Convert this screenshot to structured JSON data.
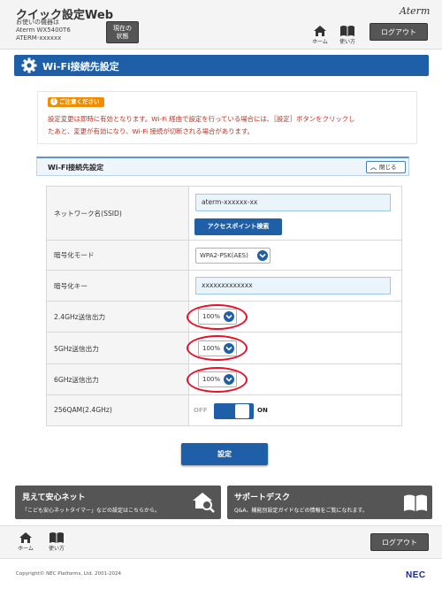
{
  "header": {
    "app_title": "クイック設定Web",
    "device_label": "お使いの機器は",
    "device_model": "Aterm WX5400T6",
    "device_id": "ATERM-xxxxxx",
    "status_button_line1": "現在の",
    "status_button_line2": "状態",
    "brand_logo": "Aterm",
    "home_label": "ホーム",
    "help_label": "使い方",
    "logout_label": "ログアウト"
  },
  "page": {
    "title": "Wi-Fi接続先設定"
  },
  "caution": {
    "badge": "ご注意ください",
    "line1": "設定変更は即時に有効となります。Wi-Fi 経由で設定を行っている場合には、［設定］ボタンをクリックし",
    "line2": "たあと、変更が有効になり、Wi-Fi 接続が切断される場合があります。"
  },
  "section": {
    "title": "Wi-Fi接続先設定",
    "collapse_label": "閉じる"
  },
  "form": {
    "ssid_label": "ネットワーク名(SSID)",
    "ssid_value": "aterm-xxxxxx-xx",
    "ap_search_label": "アクセスポイント検索",
    "encryption_label": "暗号化モード",
    "encryption_value": "WPA2-PSK(AES)",
    "key_label": "暗号化キー",
    "key_value": "xxxxxxxxxxxxx",
    "power_24_label": "2.4GHz送信出力",
    "power_24_value": "100%",
    "power_5_label": "5GHz送信出力",
    "power_5_value": "100%",
    "power_6_label": "6GHz送信出力",
    "power_6_value": "100%",
    "qam_label": "256QAM(2.4GHz)",
    "qam_off": "OFF",
    "qam_on": "ON",
    "qam_state": "ON",
    "submit_label": "設定"
  },
  "banners": {
    "safety_title": "見えて安心ネット",
    "safety_sub": "「こども安心ネットタイマー」などの設定はこちらから。",
    "support_title": "サポートデスク",
    "support_sub": "Q&A、機能別設定ガイドなどの情報をご覧になれます。"
  },
  "footer": {
    "home_label": "ホーム",
    "help_label": "使い方",
    "logout_label": "ログアウト",
    "copyright": "Copyright© NEC Platforms, Ltd. 2001-2024",
    "nec_logo": "NEC"
  },
  "colors": {
    "primary": "#1e5fa8",
    "caution_text": "#c03020",
    "caution_badge": "#f08c00",
    "highlight": "#e8102a",
    "dark_button": "#555555"
  }
}
